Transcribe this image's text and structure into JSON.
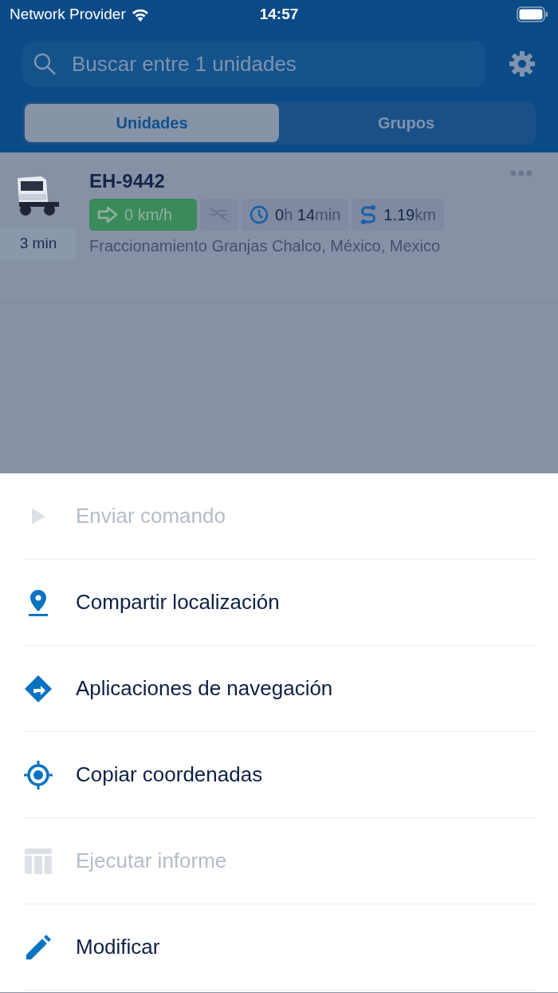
{
  "status_bar": {
    "carrier": "Network Provider",
    "time": "14:57"
  },
  "search": {
    "placeholder": "Buscar entre 1 unidades"
  },
  "tabs": [
    {
      "label": "Unidades",
      "selected": true
    },
    {
      "label": "Grupos",
      "selected": false
    }
  ],
  "units": [
    {
      "name": "EH-9442",
      "age": "3 min",
      "speed": "0 km/h",
      "moving": true,
      "duration": "**0**h **14**min",
      "distance": "**1.19**km",
      "address": "Fraccionamiento Granjas Chalco, México, Mexico"
    }
  ],
  "menu": [
    {
      "kind": "play",
      "label": "Enviar comando",
      "disabled": true
    },
    {
      "kind": "pin",
      "label": "Compartir localización",
      "disabled": false
    },
    {
      "kind": "directions",
      "label": "Aplicaciones de navegación",
      "disabled": false
    },
    {
      "kind": "target",
      "label": "Copiar coordenadas",
      "disabled": false
    },
    {
      "kind": "table",
      "label": "Ejecutar informe",
      "disabled": true
    },
    {
      "kind": "pencil",
      "label": "Modificar",
      "disabled": false
    }
  ]
}
